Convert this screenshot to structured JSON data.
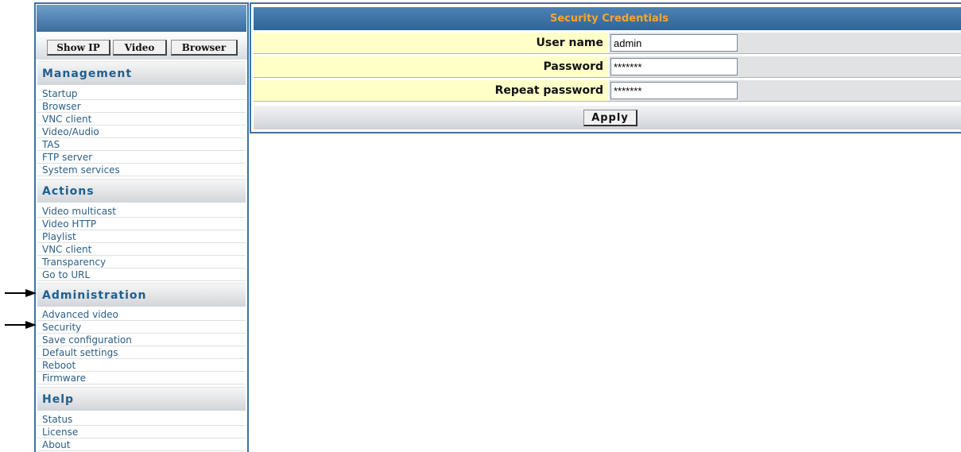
{
  "nav": {
    "buttons": [
      {
        "label": "Show IP"
      },
      {
        "label": "Video"
      },
      {
        "label": "Browser"
      }
    ],
    "sections": [
      {
        "title": "Management",
        "items": [
          "Startup",
          "Browser",
          "VNC client",
          "Video/Audio",
          "TAS",
          "FTP server",
          "System services"
        ]
      },
      {
        "title": "Actions",
        "items": [
          "Video multicast",
          "Video HTTP",
          "Playlist",
          "VNC client",
          "Transparency",
          "Go to URL"
        ]
      },
      {
        "title": "Administration",
        "items": [
          "Advanced video",
          "Security",
          "Save configuration",
          "Default settings",
          "Reboot",
          "Firmware"
        ]
      },
      {
        "title": "Help",
        "items": [
          "Status",
          "License",
          "About"
        ]
      }
    ]
  },
  "form": {
    "title": "Security Credentials",
    "fields": [
      {
        "label": "User name",
        "value": "admin"
      },
      {
        "label": "Password",
        "value": "*******"
      },
      {
        "label": "Repeat password",
        "value": "*******"
      }
    ],
    "apply_label": "Apply"
  },
  "colors": {
    "frame_blue": "#3d72a3",
    "header_text": "#f5a534",
    "nav_link": "#2c5e86",
    "label_bg": "#ffffc8"
  },
  "icons": {
    "arrow_administration": "arrow-right-icon",
    "arrow_security": "arrow-right-icon"
  }
}
